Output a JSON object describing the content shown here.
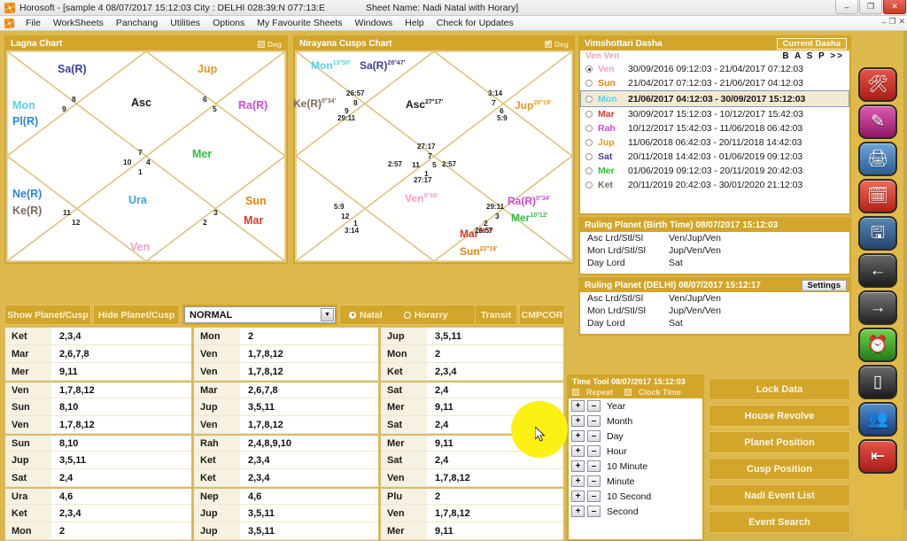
{
  "window": {
    "title": "Horosoft - [sample 4 08/07/2017 15:12:03  City : DELHI 028:39:N 077:13:E",
    "sheet_label": "Sheet Name: Nadi Natal with Horary]",
    "minimize": "–",
    "maximize": "❐",
    "close": "✕",
    "mdi_minimize": "–",
    "mdi_restore": "❐",
    "mdi_close": "✕"
  },
  "menu": [
    "File",
    "WorkSheets",
    "Panchang",
    "Utilities",
    "Options",
    "My Favourite Sheets",
    "Windows",
    "Help",
    "Check for Updates"
  ],
  "lagna": {
    "title": "Lagna Chart",
    "deg_label": "Deg",
    "deg_checked": false,
    "house_numbers": [
      "8",
      "9",
      "6",
      "5",
      "7",
      "10",
      "4",
      "1",
      "11",
      "12",
      "3",
      "2"
    ],
    "planets": [
      {
        "name": "Sa(R)",
        "color_class": "c-sat"
      },
      {
        "name": "Jup",
        "color_class": "c-jup"
      },
      {
        "name": "Asc",
        "color_class": "c-asc"
      },
      {
        "name": "Mon",
        "color_class": "c-mon"
      },
      {
        "name": "Pl(R)",
        "color_class": "c-plu"
      },
      {
        "name": "Ra(R)",
        "color_class": "c-rah"
      },
      {
        "name": "Mer",
        "color_class": "c-mer"
      },
      {
        "name": "Ne(R)",
        "color_class": "c-nep"
      },
      {
        "name": "Ke(R)",
        "color_class": "c-ket"
      },
      {
        "name": "Ura",
        "color_class": "c-ura"
      },
      {
        "name": "Sun",
        "color_class": "c-sun"
      },
      {
        "name": "Mar",
        "color_class": "c-mar"
      },
      {
        "name": "Ven",
        "color_class": "c-ven"
      }
    ]
  },
  "nirayana": {
    "title": "Nirayana Cusps Chart",
    "deg_label": "Deg",
    "deg_checked": true,
    "planets": [
      {
        "name": "Mon",
        "deg": "13°50'",
        "color_class": "c-mon"
      },
      {
        "name": "Sa(R)",
        "deg": "28°47'",
        "color_class": "c-sat"
      },
      {
        "name": "Asc",
        "deg": "27°17'",
        "color_class": "c-asc"
      },
      {
        "name": "Ke(R)",
        "deg": "0°34'",
        "color_class": "c-ket"
      },
      {
        "name": "Jup",
        "deg": "20°19'",
        "color_class": "c-jup"
      },
      {
        "name": "Ven",
        "deg": "9°38'",
        "color_class": "c-ven"
      },
      {
        "name": "Ra(R)",
        "deg": "0°34'",
        "color_class": "c-rah"
      },
      {
        "name": "Mer",
        "deg": "10°12'",
        "color_class": "c-mer"
      },
      {
        "name": "Mar",
        "deg": "28°3'",
        "color_class": "c-mar"
      },
      {
        "name": "Sun",
        "deg": "22°19'",
        "color_class": "c-sun"
      }
    ],
    "cusp_degrees": [
      "26:57",
      "29:11",
      "3:14",
      "5:9",
      "27:17",
      "2:57",
      "2:57",
      "27:17",
      "5:9",
      "3:14",
      "29:11",
      "26:57"
    ],
    "cusp_numbers": [
      "8",
      "9",
      "7",
      "6",
      "5",
      "11",
      "5",
      "1",
      "12",
      "1",
      "3",
      "2"
    ],
    "center": {
      "top_deg": "27:17",
      "top_num": "7",
      "left_deg": "2:57",
      "left_num": "11",
      "right_num": "5",
      "right_deg": "2:57",
      "bot_num": "1",
      "bot_deg": "27:17"
    }
  },
  "dasha": {
    "title": "Vimshottari Dasha",
    "current_button": "Current Dasha",
    "breadcrumb": "Ven  Ven",
    "basp": "B A S P >>",
    "rows": [
      {
        "planet": "Ven",
        "range": "30/09/2016 09:12:03 - 21/04/2017 07:12:03",
        "color_class": "c-ven",
        "selected": true
      },
      {
        "planet": "Sun",
        "range": "21/04/2017 07:12:03 - 21/06/2017 04:12:03",
        "color_class": "c-sun",
        "selected": false
      },
      {
        "planet": "Mon",
        "range": "21/06/2017 04:12:03 - 30/09/2017 15:12:03",
        "color_class": "c-mon",
        "selected": false,
        "highlight": true
      },
      {
        "planet": "Mar",
        "range": "30/09/2017 15:12:03 - 10/12/2017 15:42:03",
        "color_class": "c-mar",
        "selected": false
      },
      {
        "planet": "Rah",
        "range": "10/12/2017 15:42:03 - 11/06/2018 06:42:03",
        "color_class": "c-rah",
        "selected": false
      },
      {
        "planet": "Jup",
        "range": "11/06/2018 06:42:03 - 20/11/2018 14:42:03",
        "color_class": "c-jup",
        "selected": false
      },
      {
        "planet": "Sat",
        "range": "20/11/2018 14:42:03 - 01/06/2019 09:12:03",
        "color_class": "c-sat",
        "selected": false
      },
      {
        "planet": "Mer",
        "range": "01/06/2019 09:12:03 - 20/11/2019 20:42:03",
        "color_class": "c-mer",
        "selected": false
      },
      {
        "planet": "Ket",
        "range": "20/11/2019 20:42:03 - 30/01/2020 21:12:03",
        "color_class": "c-ket",
        "selected": false
      }
    ]
  },
  "ruling_birth": {
    "title": "Ruling Planet (Birth Time) 08/07/2017 15:12:03",
    "rows": [
      {
        "key": "Asc Lrd/Stl/Sl",
        "value": "Ven/Jup/Ven"
      },
      {
        "key": "Mon Lrd/Stl/Sl",
        "value": "Jup/Ven/Ven"
      },
      {
        "key": "Day Lord",
        "value": "Sat"
      }
    ]
  },
  "ruling_delhi": {
    "title": "Ruling Planet (DELHI) 08/07/2017 15:12:17",
    "settings_label": "Settings",
    "rows": [
      {
        "key": "Asc Lrd/Stl/Sl",
        "value": "Ven/Jup/Ven"
      },
      {
        "key": "Mon Lrd/Stl/Sl",
        "value": "Jup/Ven/Ven"
      },
      {
        "key": "Day Lord",
        "value": "Sat"
      }
    ]
  },
  "time_tool": {
    "title": "Time Tool 08/07/2017 15:12:03",
    "repeat_label": "Repeat",
    "clock_label": "Clock Time",
    "plus": "+",
    "minus": "–",
    "units": [
      "Year",
      "Month",
      "Day",
      "Hour",
      "10 Minute",
      "Minute",
      "10 Second",
      "Second"
    ]
  },
  "action_buttons": [
    "Lock Data",
    "House Revolve",
    "Planet Position",
    "Cusp Position",
    "Nadi Event List",
    "Event Search"
  ],
  "controls": {
    "show_planet_cusp": "Show Planet/Cusp",
    "hide_planet_cusp": "Hide Planet/Cusp",
    "mode_value": "NORMAL",
    "natal": "Natal",
    "horary": "Horarry",
    "natal_selected": true,
    "transit": "Transit",
    "cmpcor": "CMPCOR"
  },
  "tables": {
    "col1": [
      {
        "name": "Ket",
        "value": "2,3,4",
        "group_start": true
      },
      {
        "name": "Mar",
        "value": "2,6,7,8"
      },
      {
        "name": "Mer",
        "value": "9,11"
      },
      {
        "name": "Ven",
        "value": "1,7,8,12",
        "group_start": true
      },
      {
        "name": "Sun",
        "value": "8,10"
      },
      {
        "name": "Ven",
        "value": "1,7,8,12"
      },
      {
        "name": "Sun",
        "value": "8,10",
        "group_start": true
      },
      {
        "name": "Jup",
        "value": "3,5,11"
      },
      {
        "name": "Sat",
        "value": "2,4"
      },
      {
        "name": "Ura",
        "value": "4,6",
        "group_start": true
      },
      {
        "name": "Ket",
        "value": "2,3,4"
      },
      {
        "name": "Mon",
        "value": "2"
      }
    ],
    "col2": [
      {
        "name": "Mon",
        "value": "2",
        "group_start": true
      },
      {
        "name": "Ven",
        "value": "1,7,8,12"
      },
      {
        "name": "Ven",
        "value": "1,7,8,12"
      },
      {
        "name": "Mar",
        "value": "2,6,7,8",
        "group_start": true
      },
      {
        "name": "Jup",
        "value": "3,5,11"
      },
      {
        "name": "Ven",
        "value": "1,7,8,12"
      },
      {
        "name": "Rah",
        "value": "2,4,8,9,10",
        "group_start": true
      },
      {
        "name": "Ket",
        "value": "2,3,4"
      },
      {
        "name": "Ket",
        "value": "2,3,4"
      },
      {
        "name": "Nep",
        "value": "4,6",
        "group_start": true
      },
      {
        "name": "Jup",
        "value": "3,5,11"
      },
      {
        "name": "Jup",
        "value": "3,5,11"
      }
    ],
    "col3": [
      {
        "name": "Jup",
        "value": "3,5,11",
        "group_start": true
      },
      {
        "name": "Mon",
        "value": "2"
      },
      {
        "name": "Ket",
        "value": "2,3,4"
      },
      {
        "name": "Sat",
        "value": "2,4",
        "group_start": true
      },
      {
        "name": "Mer",
        "value": "9,11"
      },
      {
        "name": "Sat",
        "value": "2,4"
      },
      {
        "name": "Mer",
        "value": "9,11",
        "group_start": true
      },
      {
        "name": "Sat",
        "value": "2,4"
      },
      {
        "name": "Ven",
        "value": "1,7,8,12"
      },
      {
        "name": "Plu",
        "value": "2",
        "group_start": true
      },
      {
        "name": "Ven",
        "value": "1,7,8,12"
      },
      {
        "name": "Mer",
        "value": "9,11"
      }
    ]
  },
  "rail_icons": [
    {
      "name": "tools-icon",
      "glyph": "🛠",
      "cls": "ic-red"
    },
    {
      "name": "edit-icon",
      "glyph": "✎",
      "cls": "ic-mag"
    },
    {
      "name": "print-icon",
      "glyph": "🖨",
      "cls": "ic-blu"
    },
    {
      "name": "calendar-icon",
      "glyph": "🗓",
      "cls": "ic-red2"
    },
    {
      "name": "save-icon",
      "glyph": "🖫",
      "cls": "ic-nvy"
    },
    {
      "name": "back-arrow-icon",
      "glyph": "←",
      "cls": "ic-blk"
    },
    {
      "name": "forward-arrow-icon",
      "glyph": "→",
      "cls": "ic-gry"
    },
    {
      "name": "clock-icon",
      "glyph": "⏰",
      "cls": "ic-grn"
    },
    {
      "name": "book-icon",
      "glyph": "▯",
      "cls": "ic-blk"
    },
    {
      "name": "people-icon",
      "glyph": "👥",
      "cls": "ic-bl2"
    },
    {
      "name": "exit-icon",
      "glyph": "⇤",
      "cls": "ic-rd3"
    }
  ]
}
